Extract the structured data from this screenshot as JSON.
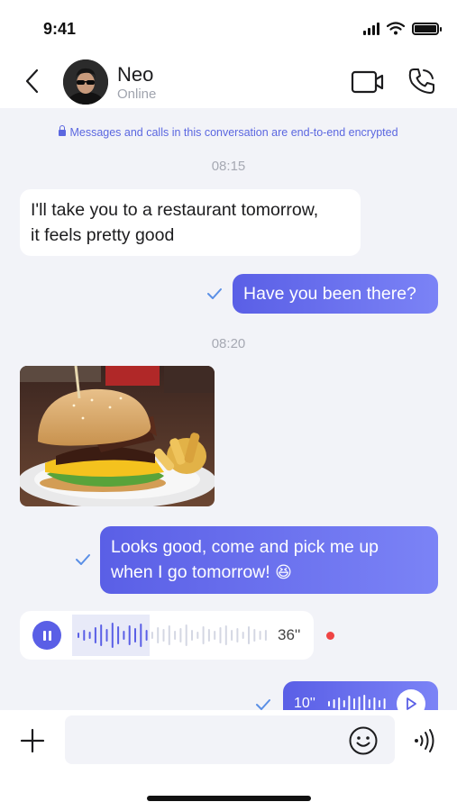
{
  "status_bar": {
    "time": "9:41",
    "icons": [
      "signal-icon",
      "wifi-icon",
      "battery-icon"
    ]
  },
  "header": {
    "contact_name": "Neo",
    "contact_status": "Online",
    "icons": {
      "back": "chevron-left-icon",
      "video": "video-camera-icon",
      "call": "phone-icon"
    }
  },
  "chat": {
    "encryption_notice": "Messages and calls in this conversation are end-to-end encrypted",
    "messages": [
      {
        "type": "timestamp",
        "text": "08:15"
      },
      {
        "type": "text",
        "direction": "incoming",
        "lines": [
          "I'll take you to a restaurant tomorrow,",
          "it feels pretty good"
        ]
      },
      {
        "type": "text",
        "direction": "outgoing",
        "text": "Have you been there?",
        "status": "read"
      },
      {
        "type": "timestamp",
        "text": "08:20"
      },
      {
        "type": "image",
        "direction": "incoming",
        "subject": "burger-photo"
      },
      {
        "type": "text",
        "direction": "outgoing",
        "lines": [
          "Looks good, come and pick me up",
          "when I go tomorrow! "
        ],
        "emoji": "😆",
        "status": "read"
      },
      {
        "type": "voice",
        "direction": "incoming",
        "duration": "36''",
        "state": "playing",
        "played_fraction": 0.38,
        "unread": true
      },
      {
        "type": "voice",
        "direction": "outgoing",
        "duration": "10''",
        "state": "paused",
        "status": "read"
      }
    ]
  },
  "composer": {
    "placeholder": "",
    "icons": {
      "attach": "plus-icon",
      "emoji": "smiley-icon",
      "voice": "voice-wave-icon"
    }
  },
  "colors": {
    "accent": "#5a5fe6",
    "accent_light": "#7b83f6",
    "chat_bg": "#f2f3f8",
    "unread_dot": "#ef4444",
    "timestamp": "#a6a9b3"
  }
}
